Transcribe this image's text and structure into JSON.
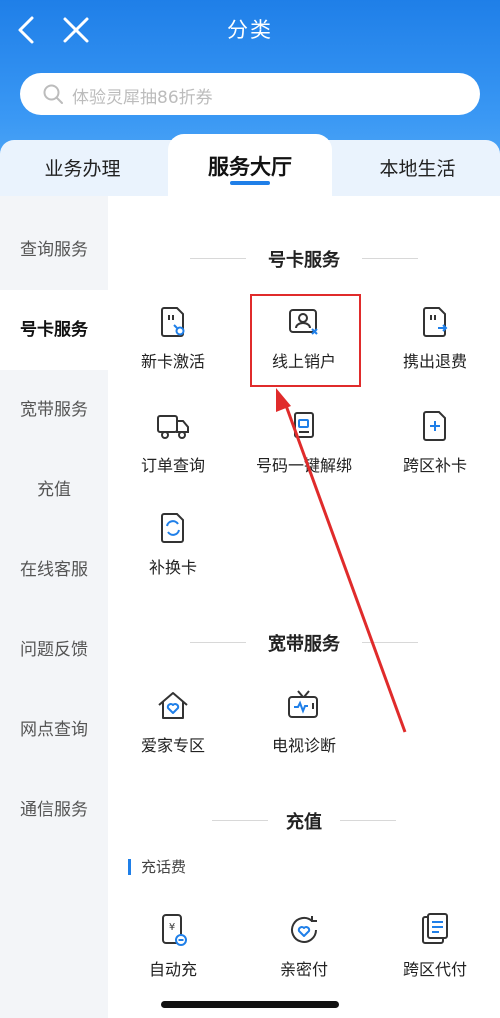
{
  "header": {
    "title": "分类",
    "search_placeholder": "体验灵犀抽86折券"
  },
  "tabs": [
    {
      "label": "业务办理"
    },
    {
      "label": "服务大厅"
    },
    {
      "label": "本地生活"
    }
  ],
  "sidebar": {
    "items": [
      {
        "label": "查询服务"
      },
      {
        "label": "号卡服务"
      },
      {
        "label": "宽带服务"
      },
      {
        "label": "充值"
      },
      {
        "label": "在线客服"
      },
      {
        "label": "问题反馈"
      },
      {
        "label": "网点查询"
      },
      {
        "label": "通信服务"
      }
    ]
  },
  "sections": [
    {
      "title": "号卡服务",
      "items": [
        {
          "label": "新卡激活",
          "icon": "sim-activate-icon"
        },
        {
          "label": "线上销户",
          "icon": "account-cancel-icon"
        },
        {
          "label": "携出退费",
          "icon": "sim-transfer-icon"
        },
        {
          "label": "订单查询",
          "icon": "truck-icon"
        },
        {
          "label": "号码一键解绑",
          "icon": "unbind-icon"
        },
        {
          "label": "跨区补卡",
          "icon": "card-add-icon"
        },
        {
          "label": "补换卡",
          "icon": "card-swap-icon"
        }
      ]
    },
    {
      "title": "宽带服务",
      "items": [
        {
          "label": "爱家专区",
          "icon": "home-heart-icon"
        },
        {
          "label": "电视诊断",
          "icon": "tv-diagnose-icon"
        }
      ]
    },
    {
      "title": "充值",
      "subtitle": "充话费",
      "items": [
        {
          "label": "自动充",
          "icon": "auto-recharge-icon"
        },
        {
          "label": "亲密付",
          "icon": "heart-pay-icon"
        },
        {
          "label": "跨区代付",
          "icon": "cross-pay-icon"
        }
      ]
    }
  ],
  "colors": {
    "brand_blue": "#1f7fe8",
    "annotation_red": "#e02b2b"
  }
}
